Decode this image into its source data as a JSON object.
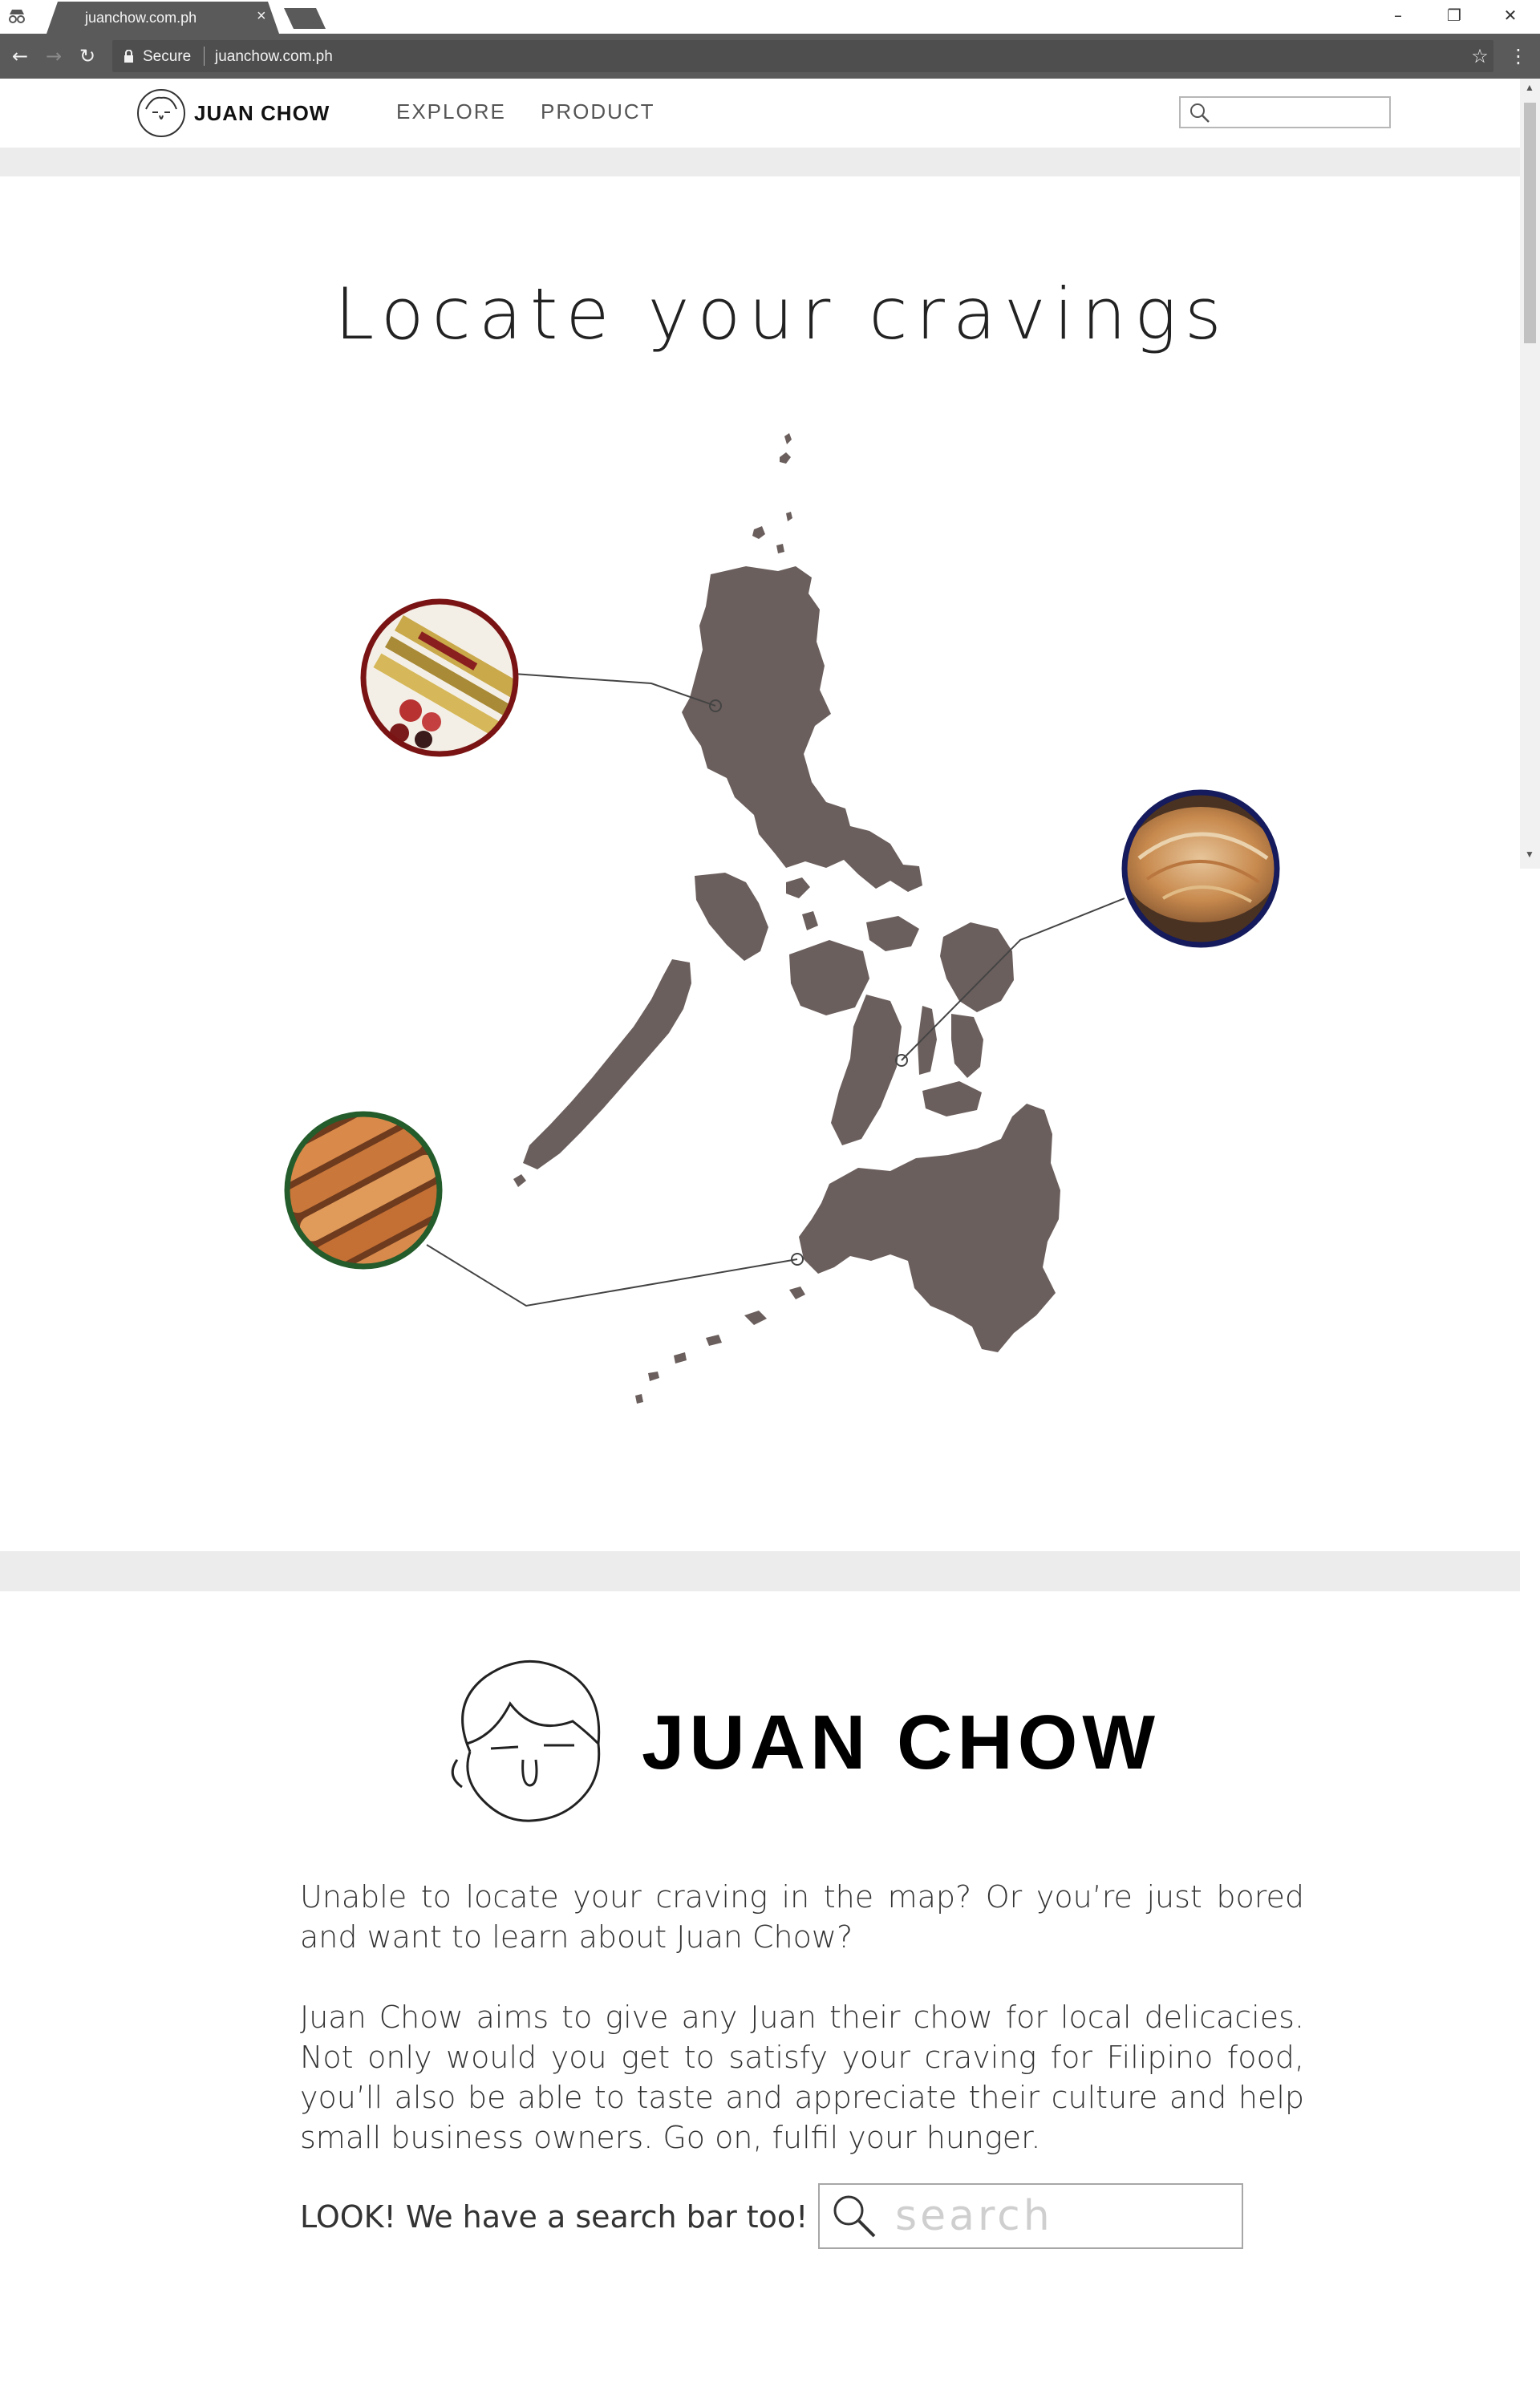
{
  "browser": {
    "tab_title": "juanchow.com.ph",
    "tab_close": "×",
    "secure_label": "Secure",
    "url": "juanchow.com.ph",
    "win_minimize": "–",
    "win_restore": "❐",
    "win_close": "✕",
    "back_glyph": "←",
    "forward_glyph": "→",
    "reload_glyph": "↻",
    "star_glyph": "☆",
    "menu_glyph": "⋮"
  },
  "header": {
    "logo_text": "JUAN CHOW",
    "nav": [
      "EXPLORE",
      "PRODUCT"
    ],
    "search_placeholder": ""
  },
  "locate": {
    "title": "Locate your cravings",
    "map_color": "#6b5f5d",
    "pins": [
      {
        "name": "luzon-pin",
        "image": "sweets-in-tray-photo",
        "ring_color": "#7a1414"
      },
      {
        "name": "visayas-pin",
        "image": "pastry-photo",
        "ring_color": "#151b5c"
      },
      {
        "name": "mindanao-pin",
        "image": "rolled-wafers-photo",
        "ring_color": "#245c2c"
      }
    ]
  },
  "about": {
    "logo_text": "JUAN CHOW",
    "para1": "Unable to locate your craving in the map? Or you’re just bored and want to learn about Juan Chow?",
    "para2": "Juan Chow aims to give any Juan their chow for local delicacies. Not only would you get to satisfy your craving for Filipino food, you’ll also be able to taste and appreciate their culture and help small business owners. Go on, fulfil your hunger.",
    "look_text": "LOOK! We have a search bar too!",
    "search_placeholder": "search"
  },
  "colors": {
    "chrome": "#5a5a5a",
    "band": "#ececec",
    "text": "#333333"
  }
}
